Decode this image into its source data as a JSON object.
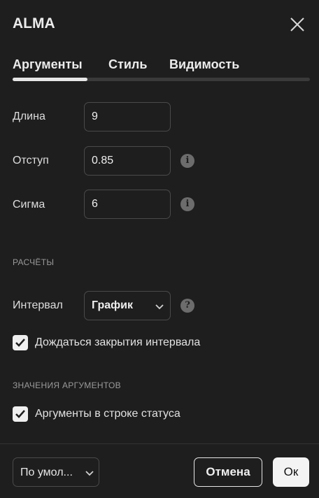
{
  "dialog": {
    "title": "ALMA"
  },
  "tabs": [
    {
      "label": "Аргументы",
      "active": true
    },
    {
      "label": "Стиль"
    },
    {
      "label": "Видимость"
    }
  ],
  "fields": {
    "length": {
      "label": "Длина",
      "value": "9"
    },
    "offset": {
      "label": "Отступ",
      "value": "0.85"
    },
    "sigma": {
      "label": "Сигма",
      "value": "6"
    }
  },
  "sections": {
    "calculations": "РАСЧЁТЫ",
    "input_values": "ЗНАЧЕНИЯ АРГУМЕНТОВ"
  },
  "interval": {
    "label": "Интервал",
    "value": "График"
  },
  "checkboxes": {
    "wait_close": {
      "label": "Дождаться закрытия интервала",
      "checked": true
    },
    "status_line": {
      "label": "Аргументы в строке статуса",
      "checked": true
    }
  },
  "footer": {
    "preset": "По умол...",
    "cancel": "Отмена",
    "ok": "Ок"
  },
  "icons": {
    "close": "close-icon",
    "info": "info-icon",
    "help": "question-icon",
    "chevron": "chevron-down-icon",
    "check": "checkmark-icon"
  }
}
